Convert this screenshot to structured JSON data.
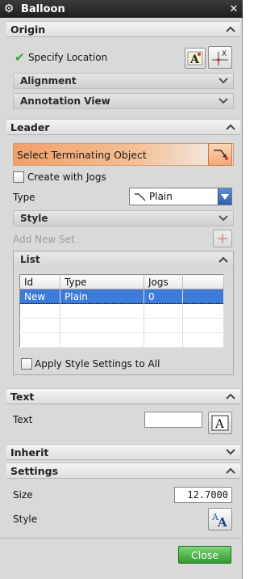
{
  "window": {
    "title": "Balloon"
  },
  "origin": {
    "header": "Origin",
    "specify_location": "Specify Location",
    "alignment": "Alignment",
    "annotation_view": "Annotation View"
  },
  "leader": {
    "header": "Leader",
    "select_terminating": "Select Terminating Object",
    "create_with_jogs": "Create with Jogs",
    "type_label": "Type",
    "type_value": "Plain",
    "style": "Style",
    "add_new_set": "Add New Set",
    "list_header": "List",
    "table": {
      "columns": [
        "Id",
        "Type",
        "Jogs"
      ],
      "rows": [
        {
          "id": "New",
          "type": "Plain",
          "jogs": "0"
        }
      ]
    },
    "apply_style": "Apply Style Settings to All"
  },
  "text_section": {
    "header": "Text",
    "label": "Text",
    "value": ""
  },
  "inherit": {
    "header": "Inherit"
  },
  "settings": {
    "header": "Settings",
    "size_label": "Size",
    "size_value": "12.7000",
    "style_label": "Style"
  },
  "footer": {
    "close_label": "Close"
  },
  "colors": {
    "title_bar": "#2b2b2b",
    "selection_highlight": "#f0a06a",
    "row_selected": "#3d7bd9",
    "close_button": "#2f9b2f",
    "check_green": "#2fa82f"
  },
  "icons": {
    "settings": "gear-icon",
    "window_close": "close-icon",
    "collapse": "chevron-up-icon",
    "expand": "chevron-down-icon",
    "check": "check-icon",
    "text_style": "text-style-icon",
    "point_dialog": "point-dialog-icon",
    "terminating_object": "terminating-object-icon",
    "dropdown": "dropdown-arrow-icon",
    "add_set": "add-set-icon",
    "text_editor": "text-editor-icon",
    "style_settings": "style-settings-icon"
  }
}
